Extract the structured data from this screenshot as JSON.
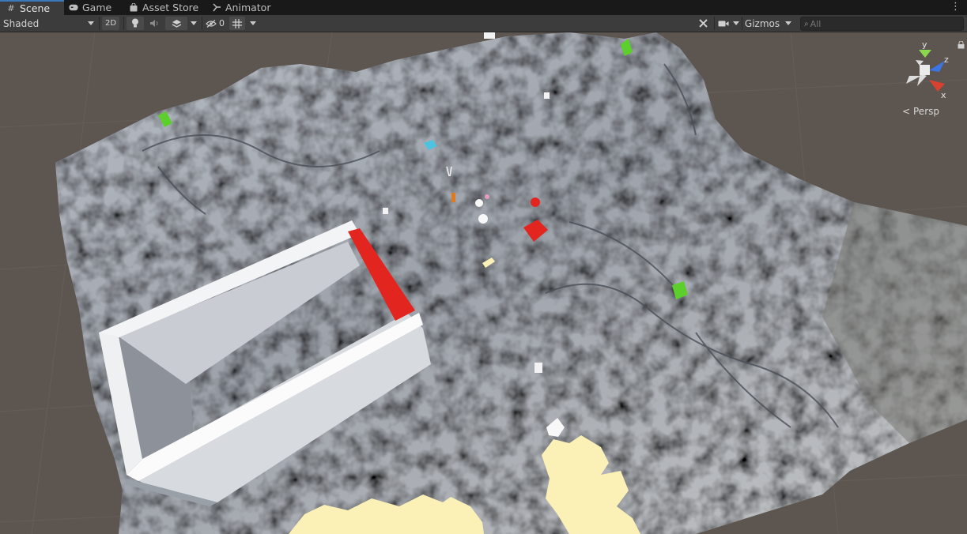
{
  "tabs": [
    {
      "label": "Scene",
      "icon": "grid-icon",
      "active": true
    },
    {
      "label": "Game",
      "icon": "gamepad-icon",
      "active": false
    },
    {
      "label": "Asset Store",
      "icon": "bag-icon",
      "active": false
    },
    {
      "label": "Animator",
      "icon": "animator-icon",
      "active": false
    }
  ],
  "toolbar": {
    "shading_mode": "Shaded",
    "mode_2d": "2D",
    "hidden_count": "0",
    "gizmos_label": "Gizmos",
    "search_placeholder": "All"
  },
  "scene": {
    "projection_label": "Persp",
    "axis_y": "y",
    "axis_z": "z",
    "axis_x": "x"
  },
  "colors": {
    "accent": "#3a79bb",
    "terrain": "#8d939b",
    "background": "#5d5650",
    "red_object": "#e3251f",
    "green_object": "#5ccf2c",
    "sand_patch": "#fbf1b6"
  }
}
